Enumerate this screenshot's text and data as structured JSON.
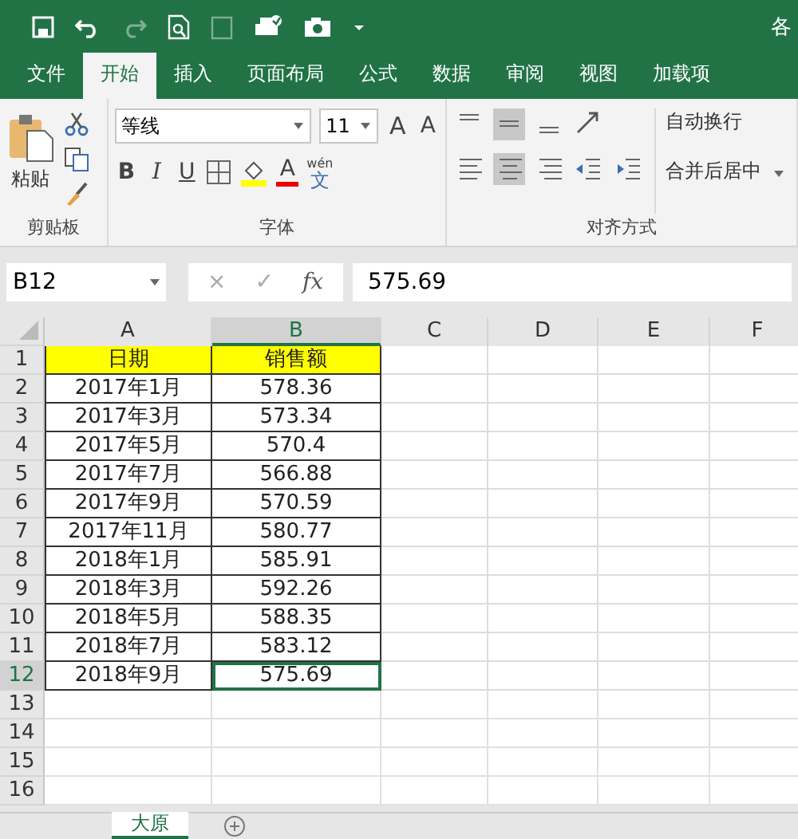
{
  "title_bar": {
    "title": "各"
  },
  "ribbon_tabs": [
    {
      "label": "文件",
      "selected": false
    },
    {
      "label": "开始",
      "selected": true
    },
    {
      "label": "插入",
      "selected": false
    },
    {
      "label": "页面布局",
      "selected": false
    },
    {
      "label": "公式",
      "selected": false
    },
    {
      "label": "数据",
      "selected": false
    },
    {
      "label": "审阅",
      "selected": false
    },
    {
      "label": "视图",
      "selected": false
    },
    {
      "label": "加载项",
      "selected": false
    }
  ],
  "ribbon": {
    "clipboard": {
      "paste": "粘贴",
      "label": "剪贴板"
    },
    "font": {
      "name": "等线",
      "size": "11",
      "grow": "A",
      "shrink": "A",
      "bold": "B",
      "italic": "I",
      "underline": "U",
      "color_letter": "A",
      "phonetic_top": "wén",
      "phonetic_char": "文",
      "label": "字体"
    },
    "alignment": {
      "vertical": [
        {
          "kind": "top",
          "selected": false
        },
        {
          "kind": "middle",
          "selected": true
        },
        {
          "kind": "bottom",
          "selected": false
        }
      ],
      "horizontal": [
        {
          "kind": "left",
          "selected": false
        },
        {
          "kind": "center",
          "selected": true
        },
        {
          "kind": "right",
          "selected": false
        }
      ],
      "wrap": "自动换行",
      "merge": "合并后居中",
      "label": "对齐方式"
    }
  },
  "formula_bar": {
    "name_box": "B12",
    "cancel": "×",
    "enter": "✓",
    "fx": "fx",
    "value": "575.69"
  },
  "sheet": {
    "columns": [
      {
        "label": "A",
        "selected": false
      },
      {
        "label": "B",
        "selected": true
      },
      {
        "label": "C",
        "selected": false
      },
      {
        "label": "D",
        "selected": false
      },
      {
        "label": "E",
        "selected": false
      },
      {
        "label": "F",
        "selected": false
      }
    ],
    "rows": [
      {
        "number": "1",
        "kind": "header",
        "selected": false,
        "cells": [
          "日期",
          "销售额"
        ]
      },
      {
        "number": "2",
        "kind": "data",
        "selected": false,
        "cells": [
          "2017年1月",
          "578.36"
        ]
      },
      {
        "number": "3",
        "kind": "data",
        "selected": false,
        "cells": [
          "2017年3月",
          "573.34"
        ]
      },
      {
        "number": "4",
        "kind": "data",
        "selected": false,
        "cells": [
          "2017年5月",
          "570.4"
        ]
      },
      {
        "number": "5",
        "kind": "data",
        "selected": false,
        "cells": [
          "2017年7月",
          "566.88"
        ]
      },
      {
        "number": "6",
        "kind": "data",
        "selected": false,
        "cells": [
          "2017年9月",
          "570.59"
        ]
      },
      {
        "number": "7",
        "kind": "data",
        "selected": false,
        "cells": [
          "2017年11月",
          "580.77"
        ]
      },
      {
        "number": "8",
        "kind": "data",
        "selected": false,
        "cells": [
          "2018年1月",
          "585.91"
        ]
      },
      {
        "number": "9",
        "kind": "data",
        "selected": false,
        "cells": [
          "2018年3月",
          "592.26"
        ]
      },
      {
        "number": "10",
        "kind": "data",
        "selected": false,
        "cells": [
          "2018年5月",
          "588.35"
        ]
      },
      {
        "number": "11",
        "kind": "data",
        "selected": false,
        "cells": [
          "2018年7月",
          "583.12"
        ]
      },
      {
        "number": "12",
        "kind": "data",
        "selected": true,
        "cells": [
          "2018年9月",
          "575.69"
        ]
      },
      {
        "number": "13",
        "kind": "empty",
        "selected": false,
        "cells": []
      },
      {
        "number": "14",
        "kind": "empty",
        "selected": false,
        "cells": []
      },
      {
        "number": "15",
        "kind": "empty",
        "selected": false,
        "cells": []
      },
      {
        "number": "16",
        "kind": "empty",
        "selected": false,
        "cells": []
      }
    ]
  },
  "sheet_tabs": [
    {
      "label": "大原",
      "selected": true
    }
  ]
}
